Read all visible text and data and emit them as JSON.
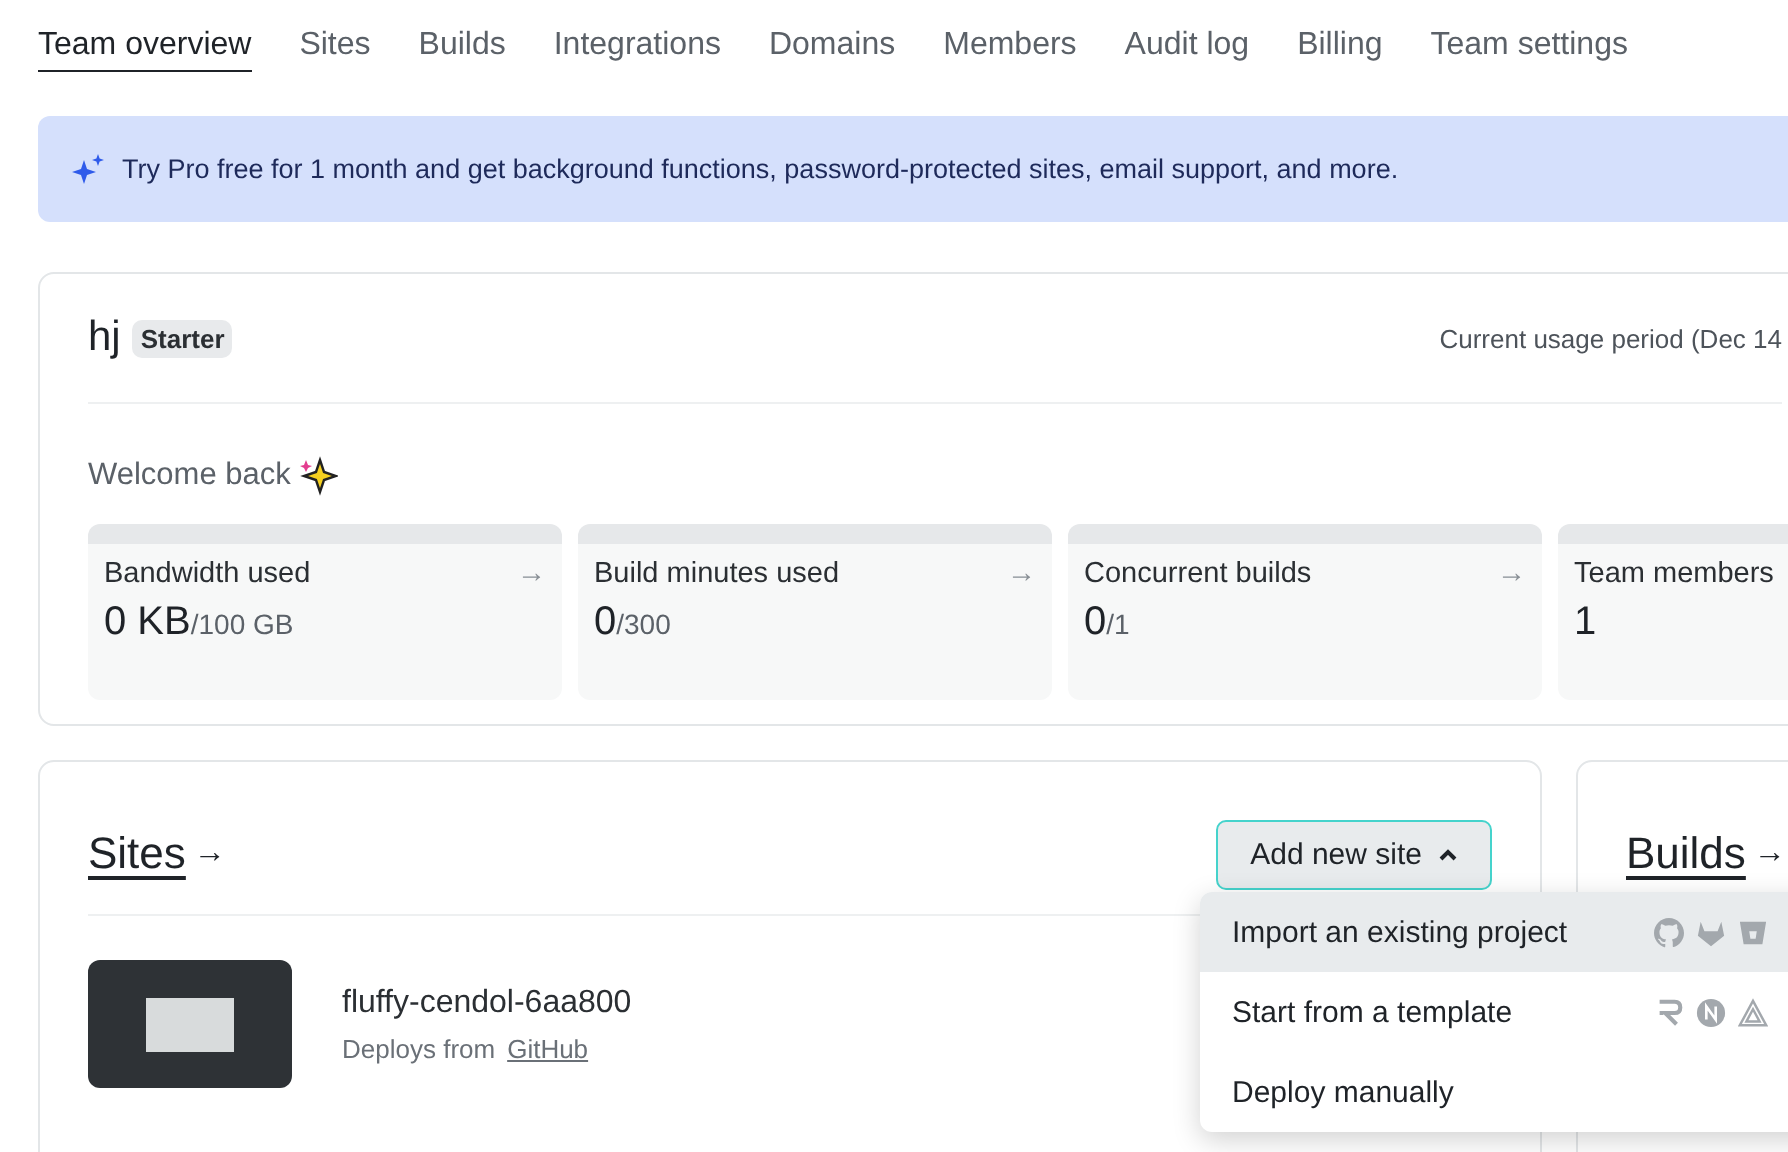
{
  "tabs": [
    {
      "label": "Team overview",
      "selected": true
    },
    {
      "label": "Sites",
      "selected": false
    },
    {
      "label": "Builds",
      "selected": false
    },
    {
      "label": "Integrations",
      "selected": false
    },
    {
      "label": "Domains",
      "selected": false
    },
    {
      "label": "Members",
      "selected": false
    },
    {
      "label": "Audit log",
      "selected": false
    },
    {
      "label": "Billing",
      "selected": false
    },
    {
      "label": "Team settings",
      "selected": false
    }
  ],
  "banner": {
    "text": "Try Pro free for 1 month and get background functions, password-protected sites, email support, and more."
  },
  "team": {
    "name": "hj",
    "plan": "Starter",
    "usage_period": "Current usage period (Dec 14"
  },
  "welcome": "Welcome back",
  "stats": [
    {
      "label": "Bandwidth used",
      "value": "0 KB",
      "limit": "/100 GB",
      "arrow": "→"
    },
    {
      "label": "Build minutes used",
      "value": "0",
      "limit": "/300",
      "arrow": "→"
    },
    {
      "label": "Concurrent builds",
      "value": "0",
      "limit": "/1",
      "arrow": "→"
    },
    {
      "label": "Team members",
      "value": "1"
    }
  ],
  "sites_panel": {
    "title": "Sites",
    "title_arrow": "→",
    "add_button": "Add new site",
    "menu_open": true,
    "menu": [
      {
        "label": "Import an existing project",
        "highlighted": true,
        "kind": "providers"
      },
      {
        "label": "Start from a template",
        "highlighted": false,
        "kind": "templates"
      },
      {
        "label": "Deploy manually",
        "highlighted": false,
        "kind": "plain"
      }
    ],
    "sites": [
      {
        "name": "fluffy-cendol-6aa800",
        "deploy_text": "Deploys from",
        "deploy_source": "GitHub"
      }
    ]
  },
  "builds_panel": {
    "title": "Builds",
    "title_arrow": "→"
  }
}
